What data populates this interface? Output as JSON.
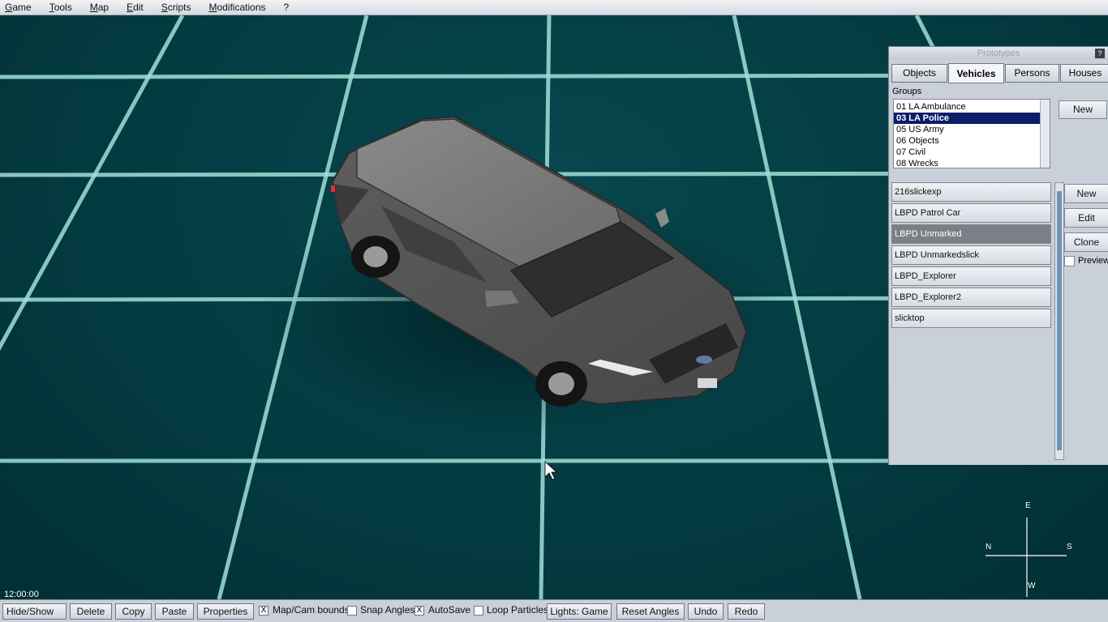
{
  "menu": [
    "Game",
    "Tools",
    "Map",
    "Edit",
    "Scripts",
    "Modifications",
    "?"
  ],
  "viewport": {
    "clock": "12:00:00"
  },
  "compass": {
    "north": "N",
    "south": "S",
    "east": "E",
    "west": "W"
  },
  "prototypes": {
    "title": "Prototypes",
    "help": "?",
    "tabs": [
      "Objects",
      "Vehicles",
      "Persons",
      "Houses"
    ],
    "active_tab": "Vehicles",
    "groups_label": "Groups",
    "groups": [
      "01 LA Ambulance",
      "03 LA Police",
      "05 US Army",
      "06 Objects",
      "07 Civil",
      "08 Wrecks"
    ],
    "selected_group": "03 LA Police",
    "groups_new": "New",
    "vehicles": [
      "216slickexp",
      "LBPD Patrol Car",
      "LBPD Unmarked",
      "LBPD Unmarkedslick",
      "LBPD_Explorer",
      "LBPD_Explorer2",
      "slicktop"
    ],
    "selected_vehicle": "LBPD Unmarked",
    "actions": {
      "new": "New",
      "edit": "Edit",
      "clone": "Clone"
    },
    "preview_label": "Preview"
  },
  "toolbar": {
    "hide_show": "Hide/Show",
    "delete": "Delete",
    "copy": "Copy",
    "paste": "Paste",
    "properties": "Properties",
    "map_cam_bounds": "Map/Cam bounds",
    "map_cam_checked": "X",
    "snap_angles": "Snap Angles",
    "autosave": "AutoSave",
    "autosave_checked": "X",
    "loop_particles": "Loop Particles",
    "lights": "Lights: Game",
    "reset_angles": "Reset Angles",
    "undo": "Undo",
    "redo": "Redo"
  }
}
